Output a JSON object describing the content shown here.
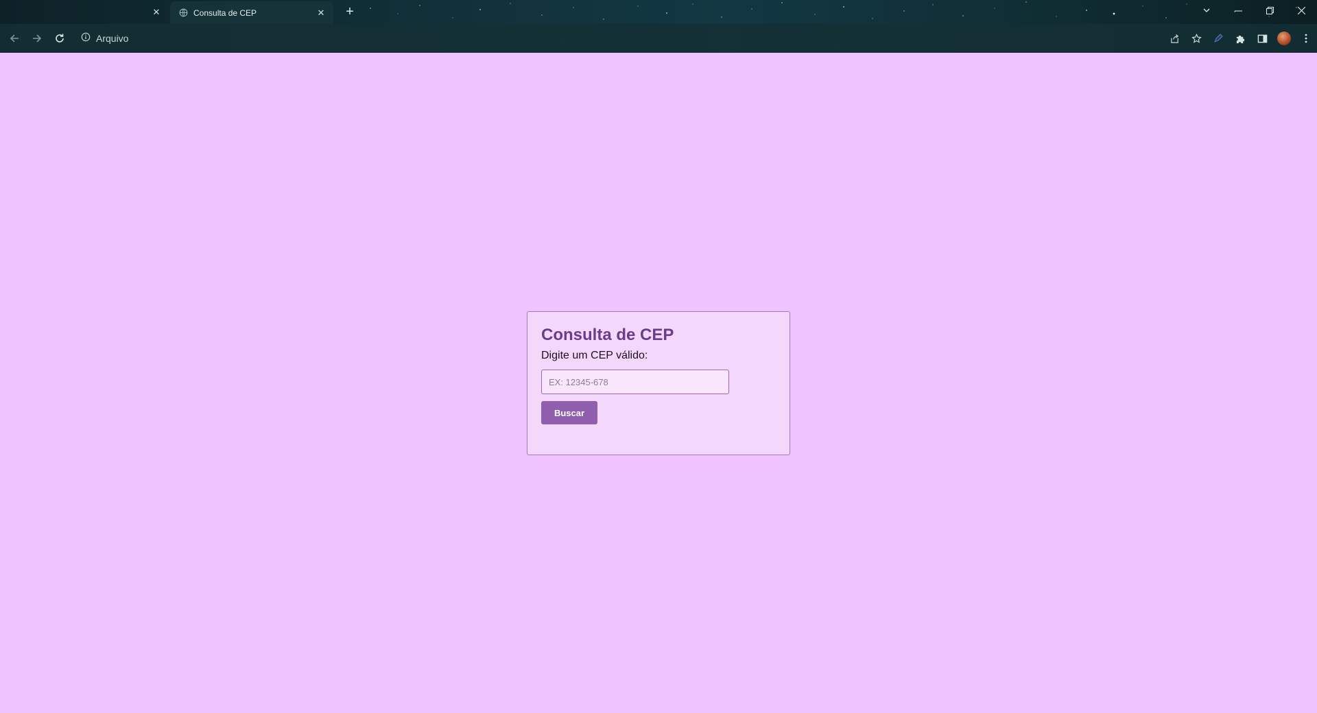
{
  "browser": {
    "tabs": [
      {
        "title": ""
      },
      {
        "title": "Consulta de CEP",
        "active": true
      }
    ],
    "address_label": "Arquivo",
    "icons": {
      "back": "arrow-left-icon",
      "forward": "arrow-right-icon",
      "reload": "reload-icon",
      "info": "info-icon",
      "share": "share-icon",
      "bookmark": "star-icon",
      "pen": "pen-icon",
      "extensions": "puzzle-icon",
      "side_panel": "side-panel-icon",
      "menu": "kebab-menu-icon"
    }
  },
  "page": {
    "title": "Consulta de CEP",
    "label": "Digite um CEP válido:",
    "input": {
      "placeholder": "EX: 12345-678",
      "value": ""
    },
    "button_label": "Buscar"
  },
  "colors": {
    "background": "#efc3fd",
    "card": "#f4d8fb",
    "title": "#6a3d8a",
    "button": "#8f5fae"
  }
}
